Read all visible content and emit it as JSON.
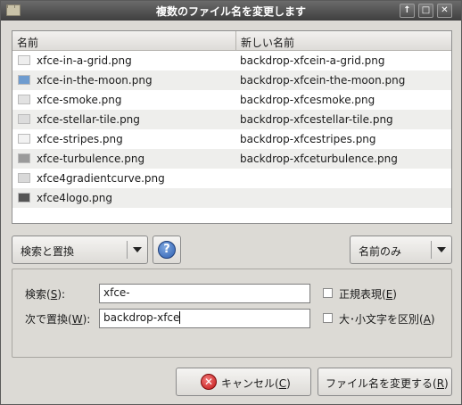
{
  "window": {
    "title": "複数のファイル名を変更します",
    "buttons": {
      "up": "↑",
      "maximize": "□",
      "close": "✕"
    }
  },
  "list": {
    "columns": [
      "名前",
      "新しい名前"
    ],
    "rows": [
      {
        "name": "xfce-in-a-grid.png",
        "new_name": "backdrop-xfcein-a-grid.png",
        "thumb_color": "#eeeeee"
      },
      {
        "name": "xfce-in-the-moon.png",
        "new_name": "backdrop-xfcein-the-moon.png",
        "thumb_color": "#6f9ccf"
      },
      {
        "name": "xfce-smoke.png",
        "new_name": "backdrop-xfcesmoke.png",
        "thumb_color": "#e2e2e2"
      },
      {
        "name": "xfce-stellar-tile.png",
        "new_name": "backdrop-xfcestellar-tile.png",
        "thumb_color": "#dcdcdc"
      },
      {
        "name": "xfce-stripes.png",
        "new_name": "backdrop-xfcestripes.png",
        "thumb_color": "#f2f2f2"
      },
      {
        "name": "xfce-turbulence.png",
        "new_name": "backdrop-xfceturbulence.png",
        "thumb_color": "#9a9a9a"
      },
      {
        "name": "xfce4gradientcurve.png",
        "new_name": "",
        "thumb_color": "#d9d9d9"
      },
      {
        "name": "xfce4logo.png",
        "new_name": "",
        "thumb_color": "#555555"
      }
    ]
  },
  "mode_combo": {
    "value": "検索と置換"
  },
  "help_button": {
    "icon": "question-icon",
    "glyph": "?"
  },
  "name_scope_combo": {
    "value": "名前のみ"
  },
  "search": {
    "label_pre": "検索(",
    "mnemonic": "S",
    "label_post": "):",
    "value": "xfce-"
  },
  "replace": {
    "label_pre": "次で置換(",
    "mnemonic": "W",
    "label_post": "):",
    "value": "backdrop-xfce"
  },
  "regex_check": {
    "label_pre": "正規表現(",
    "mnemonic": "E",
    "label_post": ")",
    "checked": false
  },
  "case_check": {
    "label_pre": "大･小文字を区別(",
    "mnemonic": "A",
    "label_post": ")",
    "checked": false
  },
  "cancel_button": {
    "label_pre": "キャンセル(",
    "mnemonic": "C",
    "label_post": ")",
    "icon_glyph": "✕"
  },
  "rename_button": {
    "label_pre": "ファイル名を変更する(",
    "mnemonic": "R",
    "label_post": ")"
  }
}
